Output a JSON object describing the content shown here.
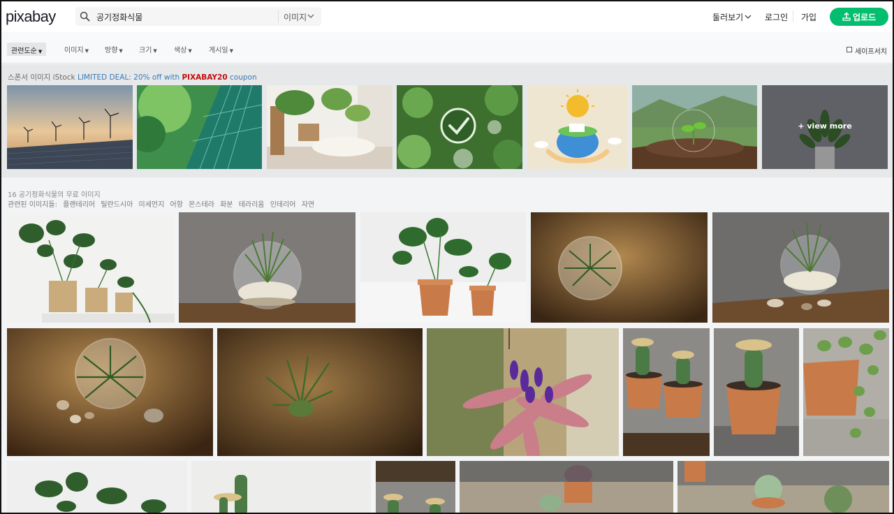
{
  "header": {
    "logo": "pixabay",
    "search_value": "공기정화식물",
    "search_type": "이미지",
    "explore_label": "둘러보기",
    "login_label": "로그인",
    "join_label": "가입",
    "upload_label": "업로드"
  },
  "filters": {
    "items": [
      "관련도순",
      "이미지",
      "방향",
      "크기",
      "색상",
      "게시일"
    ],
    "safesearch_label": "세이프서치"
  },
  "sponsored": {
    "prefix": "스폰서 이미지",
    "istock": "iStock",
    "deal": "LIMITED DEAL: 20% off with",
    "code": "PIXABAY20",
    "suffix": "coupon",
    "view_more": "+ view more"
  },
  "results": {
    "count_text": "16 공기정화식물의 무료 이미지",
    "related_label": "관련된 이미지들:",
    "related_tags": [
      "플랜테리어",
      "틸란드시아",
      "미세먼지",
      "어항",
      "몬스테라",
      "화분",
      "테라리움",
      "인테리어",
      "자연"
    ]
  },
  "colors": {
    "accent": "#02be6e",
    "link": "#3a7ab5",
    "promo_code": "#c40d0d"
  },
  "icons": {
    "search": "search-icon",
    "chevron": "chevron-down-icon",
    "upload": "upload-icon"
  }
}
